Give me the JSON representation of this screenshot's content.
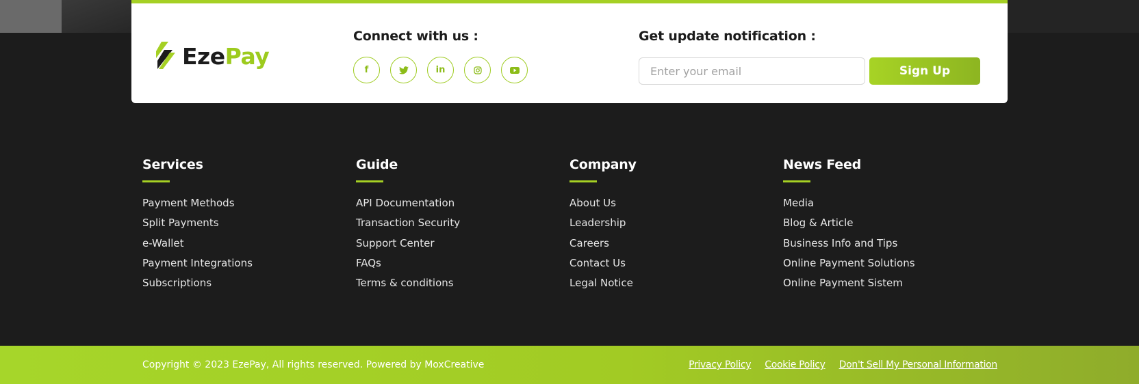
{
  "brand": {
    "name_part1": "Eze",
    "name_part2": "Pay",
    "accent_color": "#a5d024",
    "dark_color": "#1c1c1c"
  },
  "connect": {
    "title": "Connect with us :",
    "socials": [
      {
        "icon": "facebook-icon",
        "glyph": "f"
      },
      {
        "icon": "twitter-icon",
        "glyph": "t"
      },
      {
        "icon": "linkedin-icon",
        "glyph": "in"
      },
      {
        "icon": "instagram-icon",
        "glyph": "◎"
      },
      {
        "icon": "youtube-icon",
        "glyph": "▶"
      }
    ]
  },
  "notification": {
    "title": "Get update notification :",
    "email_placeholder": "Enter your email",
    "signup_label": "Sign Up"
  },
  "columns": [
    {
      "title": "Services",
      "items": [
        "Payment Methods",
        "Split Payments",
        "e-Wallet",
        "Payment Integrations",
        "Subscriptions"
      ]
    },
    {
      "title": "Guide",
      "items": [
        "API Documentation",
        "Transaction Security",
        "Support Center",
        "FAQs",
        "Terms & conditions"
      ]
    },
    {
      "title": "Company",
      "items": [
        "About Us",
        "Leadership",
        "Careers",
        "Contact Us",
        "Legal Notice"
      ]
    },
    {
      "title": "News Feed",
      "items": [
        "Media",
        "Blog & Article",
        "Business Info and Tips",
        "Online Payment Solutions",
        "Online Payment Sistem"
      ]
    }
  ],
  "footer": {
    "copyright": "Copyright © 2023 EzePay, All rights reserved. Powered by MoxCreative",
    "links": [
      "Privacy Policy",
      "Cookie Policy",
      "Don't Sell My Personal Information"
    ]
  }
}
